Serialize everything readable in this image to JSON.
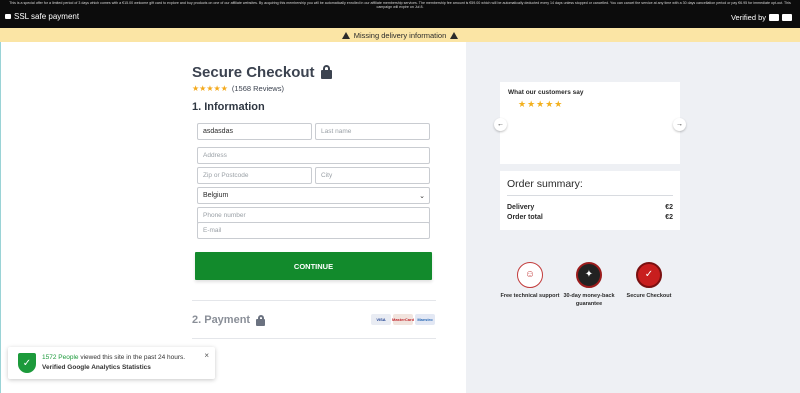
{
  "topbar": {
    "disclaimer": "This is a special offer for a limited period of 3 days which comes with a €15.00 welcome gift card to explore and buy products on one of our affiliate websites. By acquiring this membership you will be automatically enrolled in our affiliate membership services. The membership fee amount is €59.00 which will be automatically deducted every 14 days unless stopped or cancelled. You can cancel the service at any time with a 30 days cancellation period or pay €6.95 for immediate opt-out. This campaign will expire on Jul 8.",
    "ssl_label": "SSL safe payment",
    "verified_label": "Verified by"
  },
  "alert": {
    "text": "Missing delivery information"
  },
  "checkout": {
    "title": "Secure Checkout",
    "stars": "★★★★★",
    "reviews_text": "(1568 Reviews)",
    "section1": "1. Information",
    "section2": "2. Payment",
    "first_name_value": "asdasdas",
    "last_name_placeholder": "Last name",
    "address_placeholder": "Address",
    "zip_placeholder": "Zip or Postcode",
    "city_placeholder": "City",
    "country_value": "Belgium",
    "phone_placeholder": "Phone number",
    "email_placeholder": "E-mail",
    "continue_label": "CONTINUE",
    "payment_methods": [
      "VISA",
      "MasterCard",
      "Maestro"
    ]
  },
  "notification": {
    "count_text": "1572 People",
    "rest_text": " viewed this site in the past 24 hours.",
    "verified_text": "Verified Google Analytics Statistics",
    "close": "×"
  },
  "reviews_card": {
    "title": "What our customers say",
    "stars": "★★★★★",
    "prev": "←",
    "next": "→"
  },
  "summary": {
    "title": "Order summary:",
    "delivery_label": "Delivery",
    "delivery_value": "€2",
    "total_label": "Order total",
    "total_value": "€2"
  },
  "badges": [
    {
      "label": "Free technical support",
      "icon": "support-agent-icon"
    },
    {
      "label": "30-day money-back guarantee",
      "icon": "guarantee-seal-icon"
    },
    {
      "label": "Secure Checkout",
      "icon": "secure-seal-icon"
    }
  ]
}
